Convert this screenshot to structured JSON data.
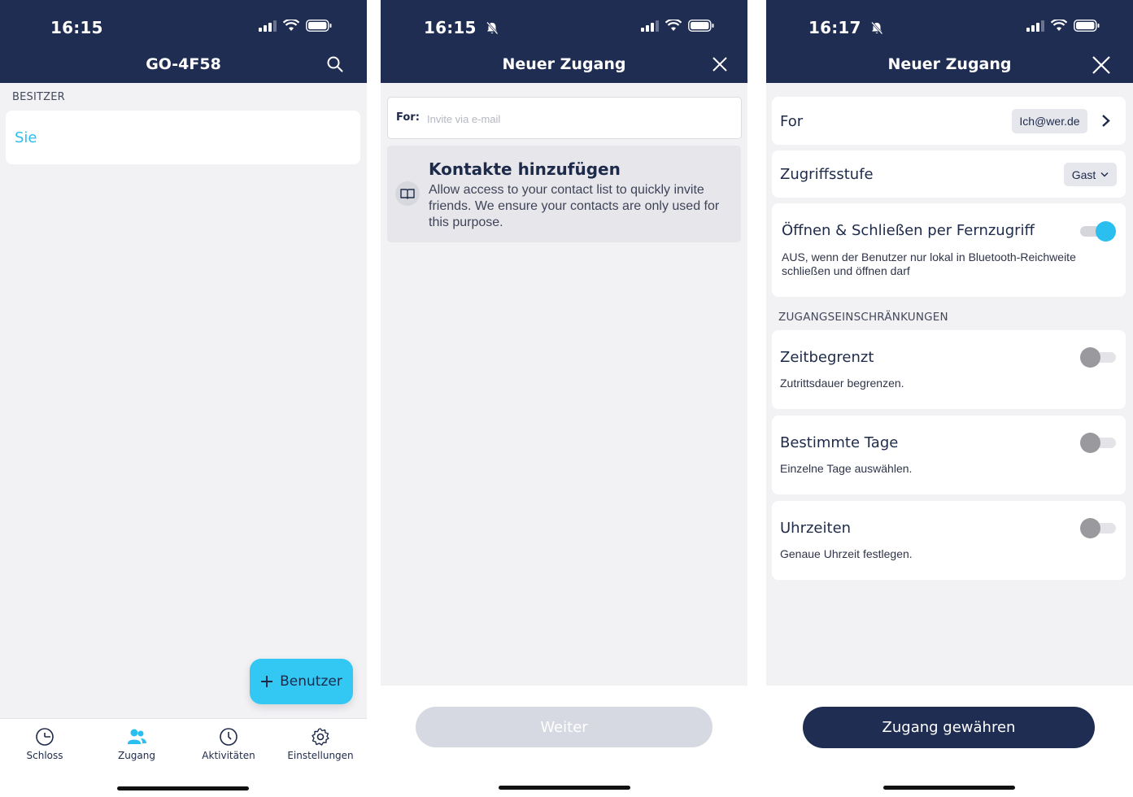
{
  "screen1": {
    "time": "16:15",
    "title": "GO-4F58",
    "section_owner": "BESITZER",
    "owner_name": "Sie",
    "fab_label": "Benutzer",
    "tabs": [
      {
        "label": "Schloss",
        "icon": "lock-gauge-icon"
      },
      {
        "label": "Zugang",
        "icon": "users-icon",
        "active": true
      },
      {
        "label": "Aktivitäten",
        "icon": "clock-icon"
      },
      {
        "label": "Einstellungen",
        "icon": "gear-icon"
      }
    ],
    "active_color": "#2bbff0"
  },
  "screen2": {
    "time": "16:15",
    "title": "Neuer Zugang",
    "for_label": "For:",
    "for_placeholder": "Invite via e-mail",
    "contacts_title": "Kontakte hinzufügen",
    "contacts_text": "Allow access to your contact list to quickly invite friends. We ensure your contacts are only used for this purpose.",
    "next_button": "Weiter"
  },
  "screen3": {
    "time": "16:17",
    "title": "Neuer Zugang",
    "for_label": "For",
    "for_value": "Ich@wer.de",
    "access_level_label": "Zugriffsstufe",
    "access_level_value": "Gast",
    "remote_title": "Öffnen & Schließen per Fernzugriff",
    "remote_desc": "AUS, wenn der Benutzer nur lokal in Bluetooth-Reichweite schließen und öffnen darf",
    "remote_enabled": true,
    "restrictions_label": "ZUGANGSEINSCHRÄNKUNGEN",
    "time_limited_title": "Zeitbegrenzt",
    "time_limited_desc": "Zutrittsdauer begrenzen.",
    "specific_days_title": "Bestimmte Tage",
    "specific_days_desc": "Einzelne Tage auswählen.",
    "times_title": "Uhrzeiten",
    "times_desc": "Genaue Uhrzeit festlegen.",
    "grant_button": "Zugang gewähren"
  },
  "colors": {
    "header": "#1f2d52",
    "accent": "#2bbff0",
    "fab": "#33c7f4",
    "background": "#f2f2f5"
  }
}
